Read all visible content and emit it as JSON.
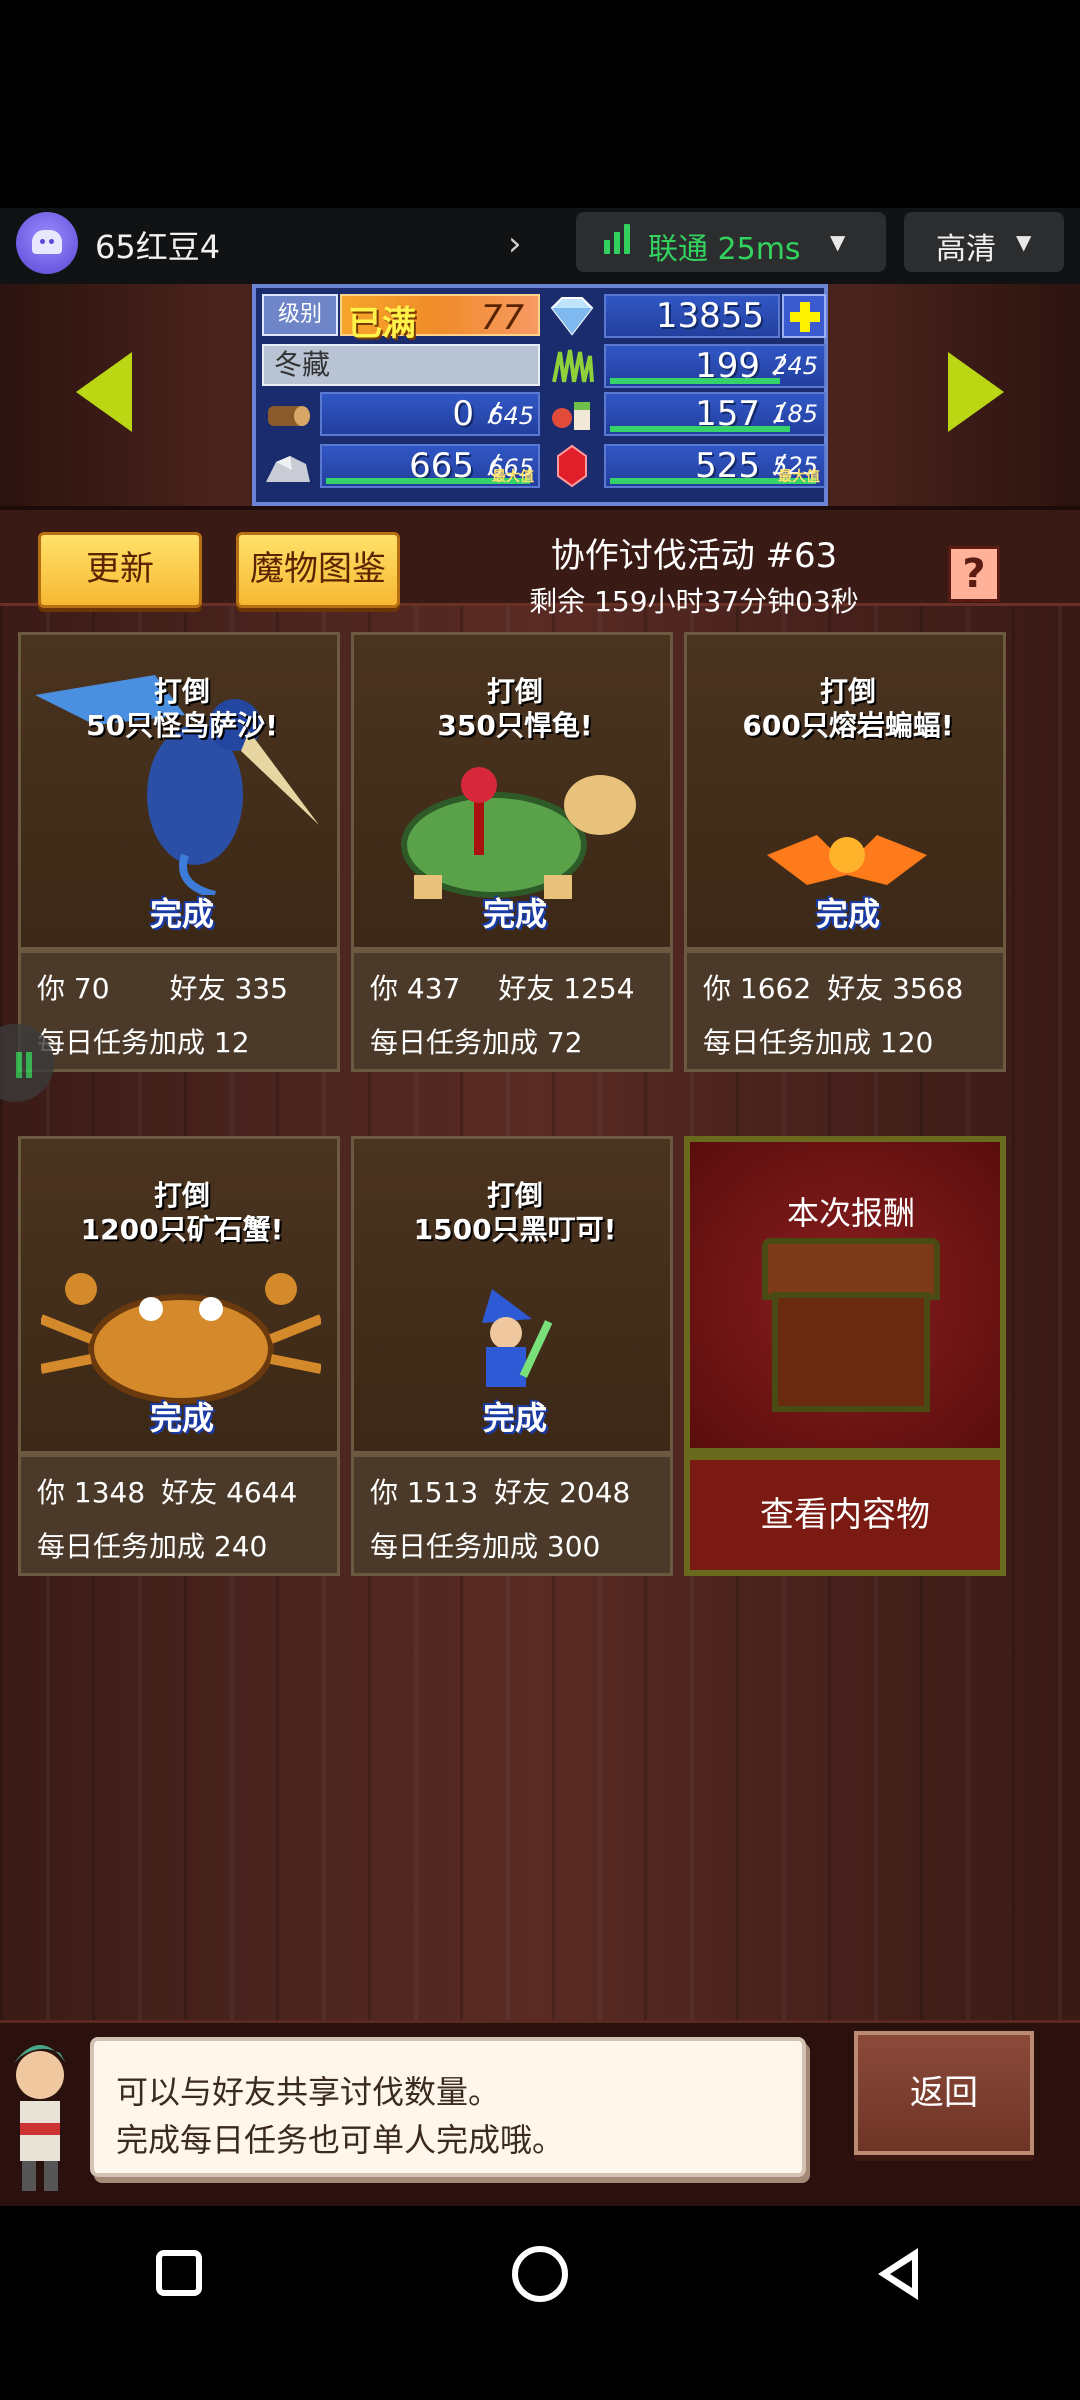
{
  "stream_bar": {
    "device_name": "65红豆4",
    "network_label": "联通 25ms",
    "quality_label": "高清"
  },
  "hud": {
    "level_label": "级别",
    "level_max": "已满",
    "level_value": "77",
    "season": "冬藏",
    "gems": "13855",
    "resources": [
      {
        "icon": "wood-log-icon",
        "value": "0",
        "max": "645",
        "level": 0.0
      },
      {
        "icon": "stone-ore-icon",
        "value": "665",
        "max": "665",
        "level": 1.0,
        "tag": "最大值"
      },
      {
        "icon": "grass-icon",
        "value": "199",
        "max": "245",
        "level": 0.81
      },
      {
        "icon": "food-icon",
        "value": "157",
        "max": "185",
        "level": 0.85
      },
      {
        "icon": "ruby-icon",
        "value": "525",
        "max": "525",
        "level": 1.0,
        "tag": "最大值"
      }
    ]
  },
  "event": {
    "refresh_label": "更新",
    "bestiary_label": "魔物图鉴",
    "title": "协作讨伐活动 #63",
    "time_left": "剩余 159小时37分钟03秒",
    "help_label": "?"
  },
  "quests": [
    {
      "title_line1": "打倒",
      "title_line2": "50只怪鸟萨沙!",
      "status": "完成",
      "you_label": "你",
      "you": "70",
      "friend_label": "好友",
      "friend": "335",
      "bonus_label": "每日任务加成",
      "bonus": "12"
    },
    {
      "title_line1": "打倒",
      "title_line2": "350只悍龟!",
      "status": "完成",
      "you_label": "你",
      "you": "437",
      "friend_label": "好友",
      "friend": "1254",
      "bonus_label": "每日任务加成",
      "bonus": "72"
    },
    {
      "title_line1": "打倒",
      "title_line2": "600只熔岩蝙蝠!",
      "status": "完成",
      "you_label": "你",
      "you": "1662",
      "friend_label": "好友",
      "friend": "3568",
      "bonus_label": "每日任务加成",
      "bonus": "120"
    },
    {
      "title_line1": "打倒",
      "title_line2": "1200只矿石蟹!",
      "status": "完成",
      "you_label": "你",
      "you": "1348",
      "friend_label": "好友",
      "friend": "4644",
      "bonus_label": "每日任务加成",
      "bonus": "240"
    },
    {
      "title_line1": "打倒",
      "title_line2": "1500只黑叮可!",
      "status": "完成",
      "you_label": "你",
      "you": "1513",
      "friend_label": "好友",
      "friend": "2048",
      "bonus_label": "每日任务加成",
      "bonus": "300"
    }
  ],
  "reward": {
    "label": "本次报酬",
    "button": "查看内容物"
  },
  "dialog": {
    "line1": "可以与好友共享讨伐数量。",
    "line2": "完成每日任务也可单人完成哦。",
    "back_label": "返回"
  },
  "colors": {
    "accent_green": "#33d15d",
    "arrow_yellow_green": "#b9d813",
    "hud_blue": "#1a2c6e"
  }
}
